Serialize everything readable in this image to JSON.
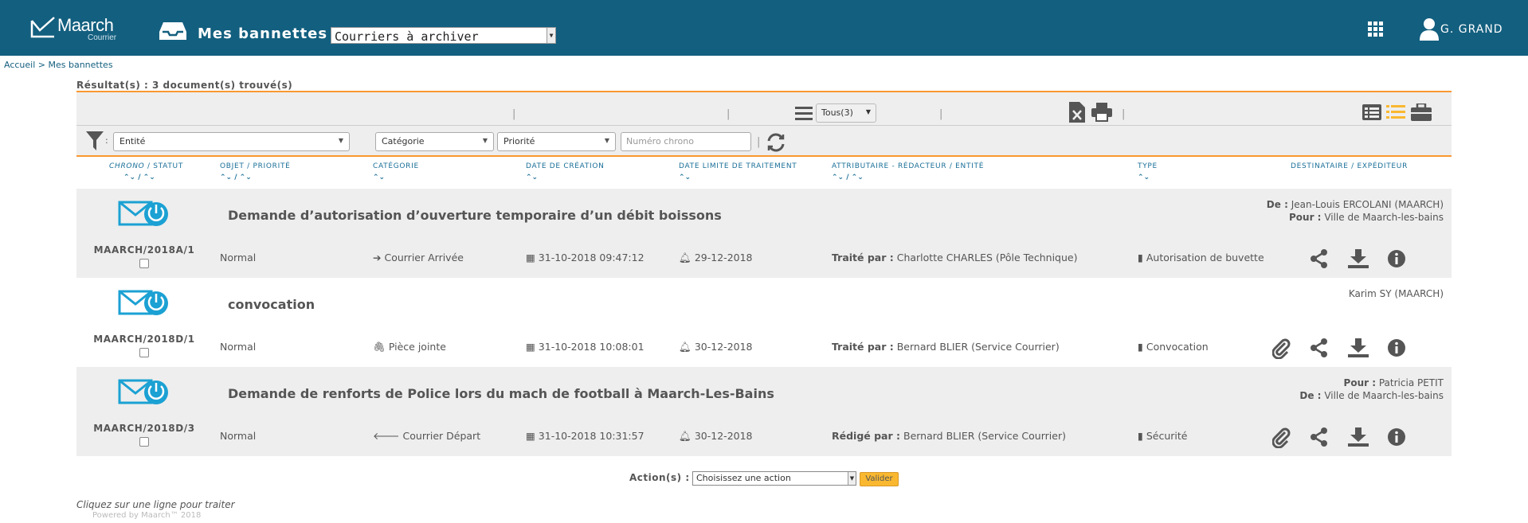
{
  "header": {
    "brand": "Maarch",
    "brand_sub": "Courrier",
    "bannettes_label": "Mes bannettes :",
    "bannette_selected": "Courriers à archiver",
    "user_name": "G. GRAND",
    "colors": {
      "header_bg": "#135f7f",
      "accent": "#f99830",
      "icon_blue": "#1ba1d3"
    }
  },
  "breadcrumb": {
    "home": "Accueil",
    "separator": " > ",
    "current": "Mes bannettes"
  },
  "results": {
    "text": "Résultat(s) : 3 document(s) trouvé(s)"
  },
  "toolbar": {
    "display_select": "Tous(3)",
    "icons": [
      "list-lines-icon",
      "excel-export-icon",
      "print-icon",
      "list-view-icon",
      "list-detail-view-icon",
      "briefcase-icon"
    ]
  },
  "filters": {
    "colon": ":",
    "entity_placeholder": "Entité",
    "category_placeholder": "Catégorie",
    "priority_placeholder": "Priorité",
    "chrono_placeholder": "Numéro chrono"
  },
  "columns": {
    "chrono": "Chrono",
    "statut": " / Statut",
    "objet": "Objet / Priorité",
    "categorie": "Catégorie",
    "date_creation": "Date de création",
    "date_limite": "Date limite de traitement",
    "attributaire": "Attributaire - Rédacteur / Entité",
    "type": "Type",
    "destinataire": "Destinataire / Expéditeur",
    "sort_sep": "/"
  },
  "rows": [
    {
      "chrono": "MAARCH/2018A/1",
      "subject": "Demande d’autorisation d’ouverture temporaire d’un débit boissons",
      "priority": "Normal",
      "category": "Courrier Arrivée",
      "category_icon": "arrow-right-icon",
      "created": "31-10-2018 09:47:12",
      "deadline": "29-12-2018",
      "handler_label": "Traité par :",
      "handler": "Charlotte CHARLES (Pôle Technique)",
      "type": "Autorisation de buvette",
      "corr_line1_label": "De :",
      "corr_line1": "Jean-Louis ERCOLANI (MAARCH)",
      "corr_line2_label": "Pour :",
      "corr_line2": "Ville de Maarch-les-bains"
    },
    {
      "chrono": "MAARCH/2018D/1",
      "subject": "convocation",
      "priority": "Normal",
      "category": "Pièce jointe",
      "category_icon": "paperclip-icon",
      "created": "31-10-2018 10:08:01",
      "deadline": "30-12-2018",
      "handler_label": "Traité par :",
      "handler": "Bernard BLIER (Service Courrier)",
      "type": "Convocation",
      "corr_line1_label": "",
      "corr_line1": "Karim SY (MAARCH)",
      "corr_line2_label": "",
      "corr_line2": ""
    },
    {
      "chrono": "MAARCH/2018D/3",
      "subject": "Demande de renforts de Police lors du mach de football à Maarch-Les-Bains",
      "priority": "Normal",
      "category": "Courrier Départ",
      "category_icon": "arrow-left-icon",
      "created": "31-10-2018 10:31:57",
      "deadline": "30-12-2018",
      "handler_label": "Rédigé par :",
      "handler": "Bernard BLIER (Service Courrier)",
      "type": "Sécurité",
      "corr_line1_label": "Pour :",
      "corr_line1": "Patricia PETIT",
      "corr_line2_label": "De :",
      "corr_line2": "Ville de Maarch-les-bains"
    }
  ],
  "footer": {
    "action_label": "Action(s) :",
    "action_select": "Choisissez une action",
    "validate_button": "Valider",
    "hint": "Cliquez sur une ligne pour traiter",
    "powered": "Powered by Maarch™ 2018"
  }
}
